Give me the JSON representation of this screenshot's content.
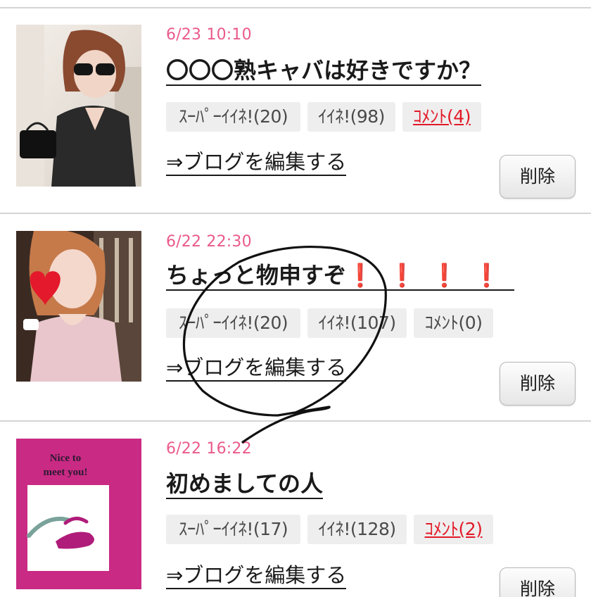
{
  "posts": [
    {
      "date": "6/23 10:10",
      "title": "〇〇〇熟キャバは好きですか？",
      "title_exclaim": "",
      "super_like": "ｽｰﾊﾟｰｲｲﾈ!(20)",
      "like": "ｲｲﾈ!(98)",
      "comment": "ｺﾒﾝﾄ(4)",
      "edit_link": "⇒ブログを編集する",
      "delete_label": "削除"
    },
    {
      "date": "6/22 22:30",
      "title": "ちょっと物申すぞ",
      "title_exclaim": "❗❗❗❗",
      "super_like": "ｽｰﾊﾟｰｲｲﾈ!(20)",
      "like": "ｲｲﾈ!(107)",
      "comment": "ｺﾒﾝﾄ(0)",
      "edit_link": "⇒ブログを編集する",
      "delete_label": "削除"
    },
    {
      "date": "6/22 16:22",
      "title": "初めましての人",
      "title_exclaim": "",
      "super_like": "ｽｰﾊﾟｰｲｲﾈ!(17)",
      "like": "ｲｲﾈ!(128)",
      "comment": "ｺﾒﾝﾄ(2)",
      "edit_link": "⇒ブログを編集する",
      "delete_label": "削除",
      "thumb_text": "Nice to meet you!"
    }
  ],
  "colors": {
    "date": "#ea5a8c",
    "comment_active": "#e21a28",
    "thumb3_bg": "#c92a84"
  }
}
